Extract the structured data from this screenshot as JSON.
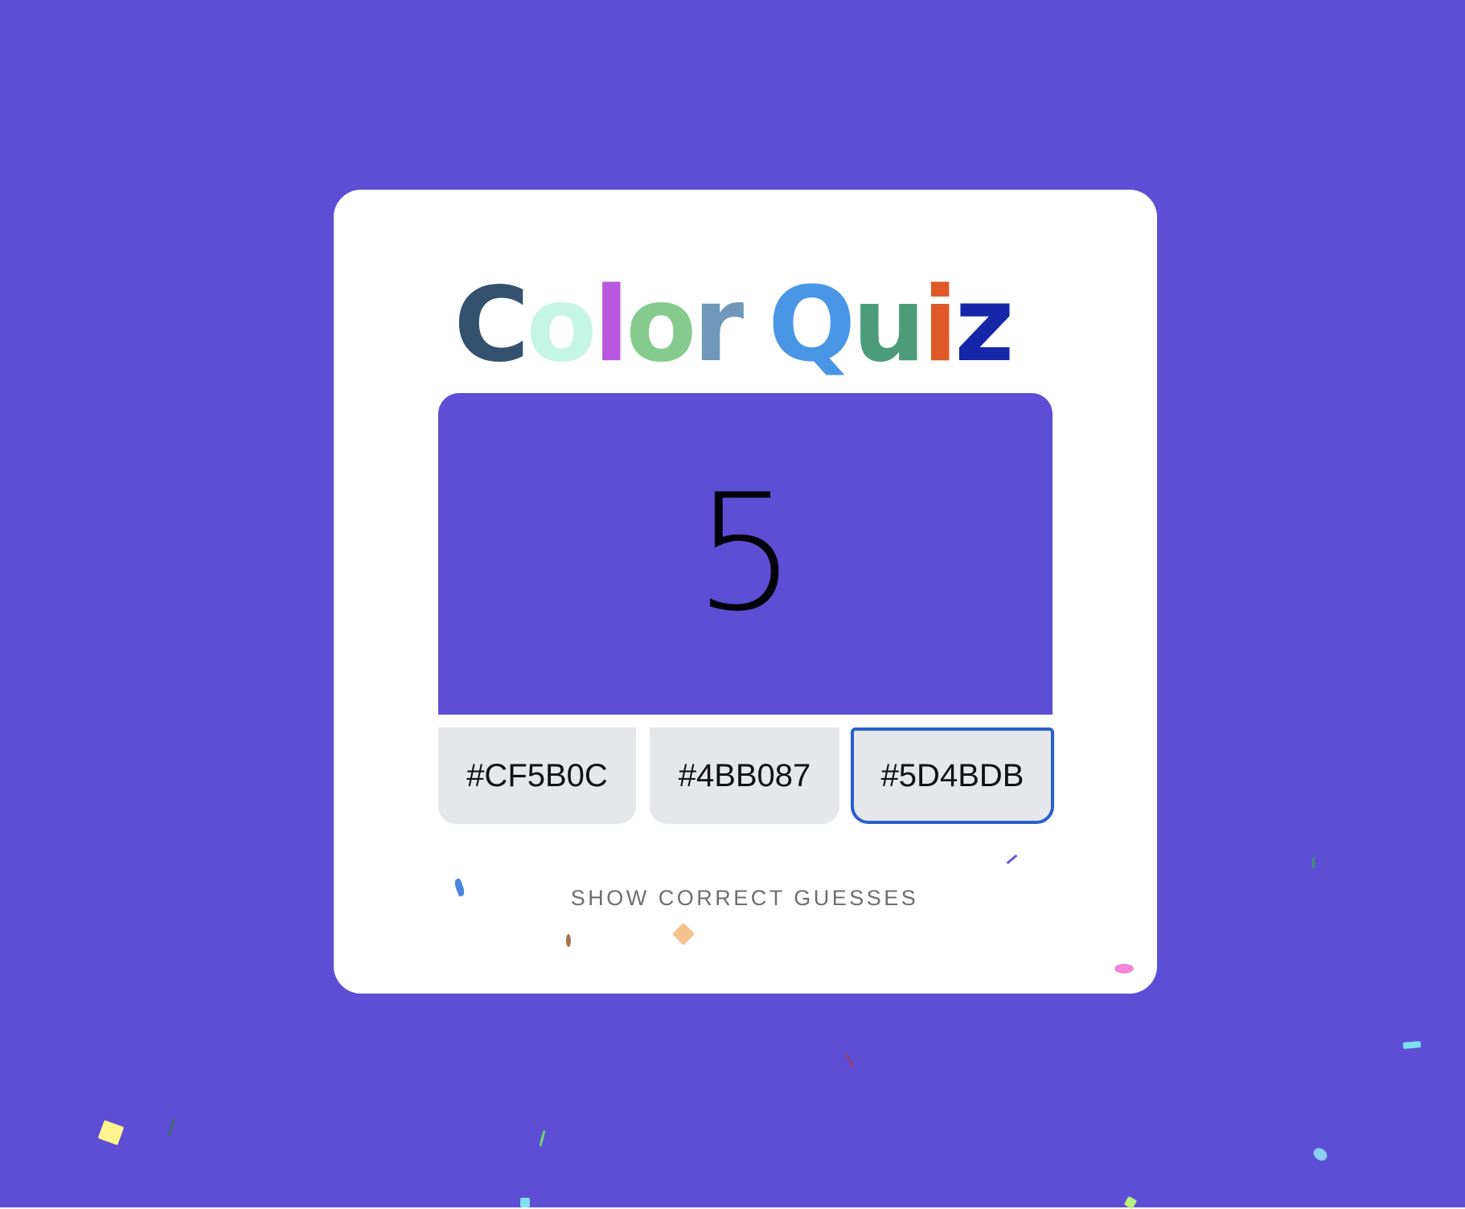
{
  "page": {
    "background": "#5D4ED5"
  },
  "title": {
    "letters": [
      {
        "char": "C",
        "color": "#34526F"
      },
      {
        "char": "o",
        "color": "#C5F5E4"
      },
      {
        "char": "l",
        "color": "#B857E0"
      },
      {
        "char": "o",
        "color": "#86CB8E"
      },
      {
        "char": "r",
        "color": "#6F98BA"
      },
      {
        "char": " ",
        "color": "#000000"
      },
      {
        "char": "Q",
        "color": "#4996E6"
      },
      {
        "char": "u",
        "color": "#4C9C7C"
      },
      {
        "char": "i",
        "color": "#DE5828"
      },
      {
        "char": "z",
        "color": "#1527A8"
      }
    ]
  },
  "swatch": {
    "color": "#5D4ED5",
    "countdown": "5"
  },
  "options": [
    {
      "label": "#CF5B0C",
      "selected": false
    },
    {
      "label": "#4BB087",
      "selected": false
    },
    {
      "label": "#5D4BDB",
      "selected": true
    }
  ],
  "show_guesses": {
    "label": "SHOW CORRECT GUESSES"
  },
  "confetti_colors": [
    "#4D86E0",
    "#A97047",
    "#F6C28F",
    "#6F5BD6",
    "#F484D8",
    "#FFF58F",
    "#3F6E68",
    "#6FD36A",
    "#7FE0F0",
    "#8ACDF5",
    "#9B3F6F",
    "#3E8E6E",
    "#B9F07A"
  ]
}
